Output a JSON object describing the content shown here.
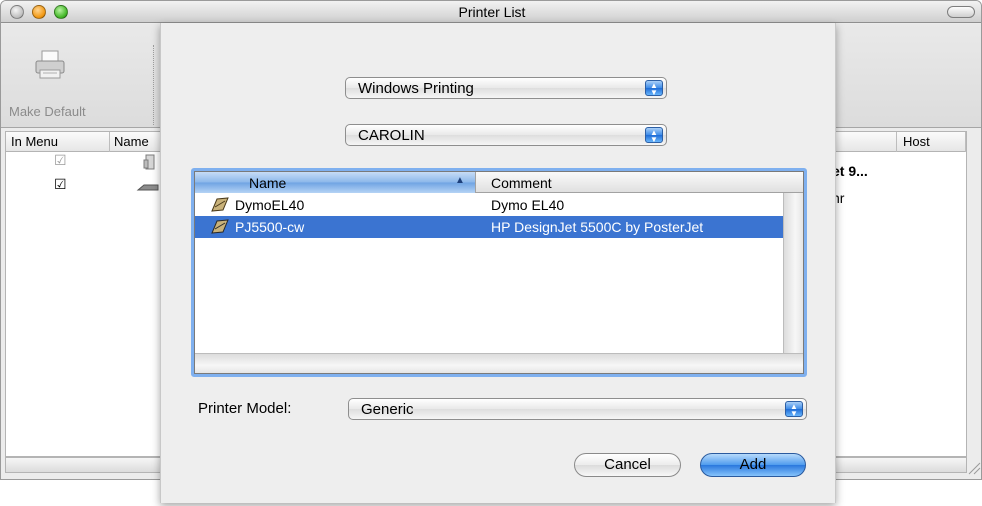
{
  "window": {
    "title": "Printer List"
  },
  "toolbar": {
    "make_default_label": "Make Default"
  },
  "printer_list": {
    "columns": [
      "In Menu",
      "Name",
      "Host"
    ],
    "rows": [
      {
        "in_menu": "☑",
        "partial_name": "et 9..."
      },
      {
        "in_menu": "☑",
        "partial_name": "nr"
      }
    ]
  },
  "sheet": {
    "connection_popup": "Windows Printing",
    "workgroup_popup": "CAROLIN",
    "table": {
      "columns": [
        "Name",
        "Comment"
      ],
      "rows": [
        {
          "name": "DymoEL40",
          "comment": "Dymo EL40",
          "selected": false
        },
        {
          "name": "PJ5500-cw",
          "comment": "HP DesignJet 5500C by PosterJet",
          "selected": true
        }
      ]
    },
    "printer_model_label": "Printer Model:",
    "printer_model_value": "Generic",
    "cancel_label": "Cancel",
    "add_label": "Add"
  },
  "icons": {
    "printer": "printer-icon",
    "sort": "sort-up-arrow-icon",
    "popup": "up-down-arrows-icon"
  },
  "colors": {
    "selection": "#3b74d1",
    "accent_button": "#2a78de",
    "focus_ring": "#7fb0ef"
  }
}
